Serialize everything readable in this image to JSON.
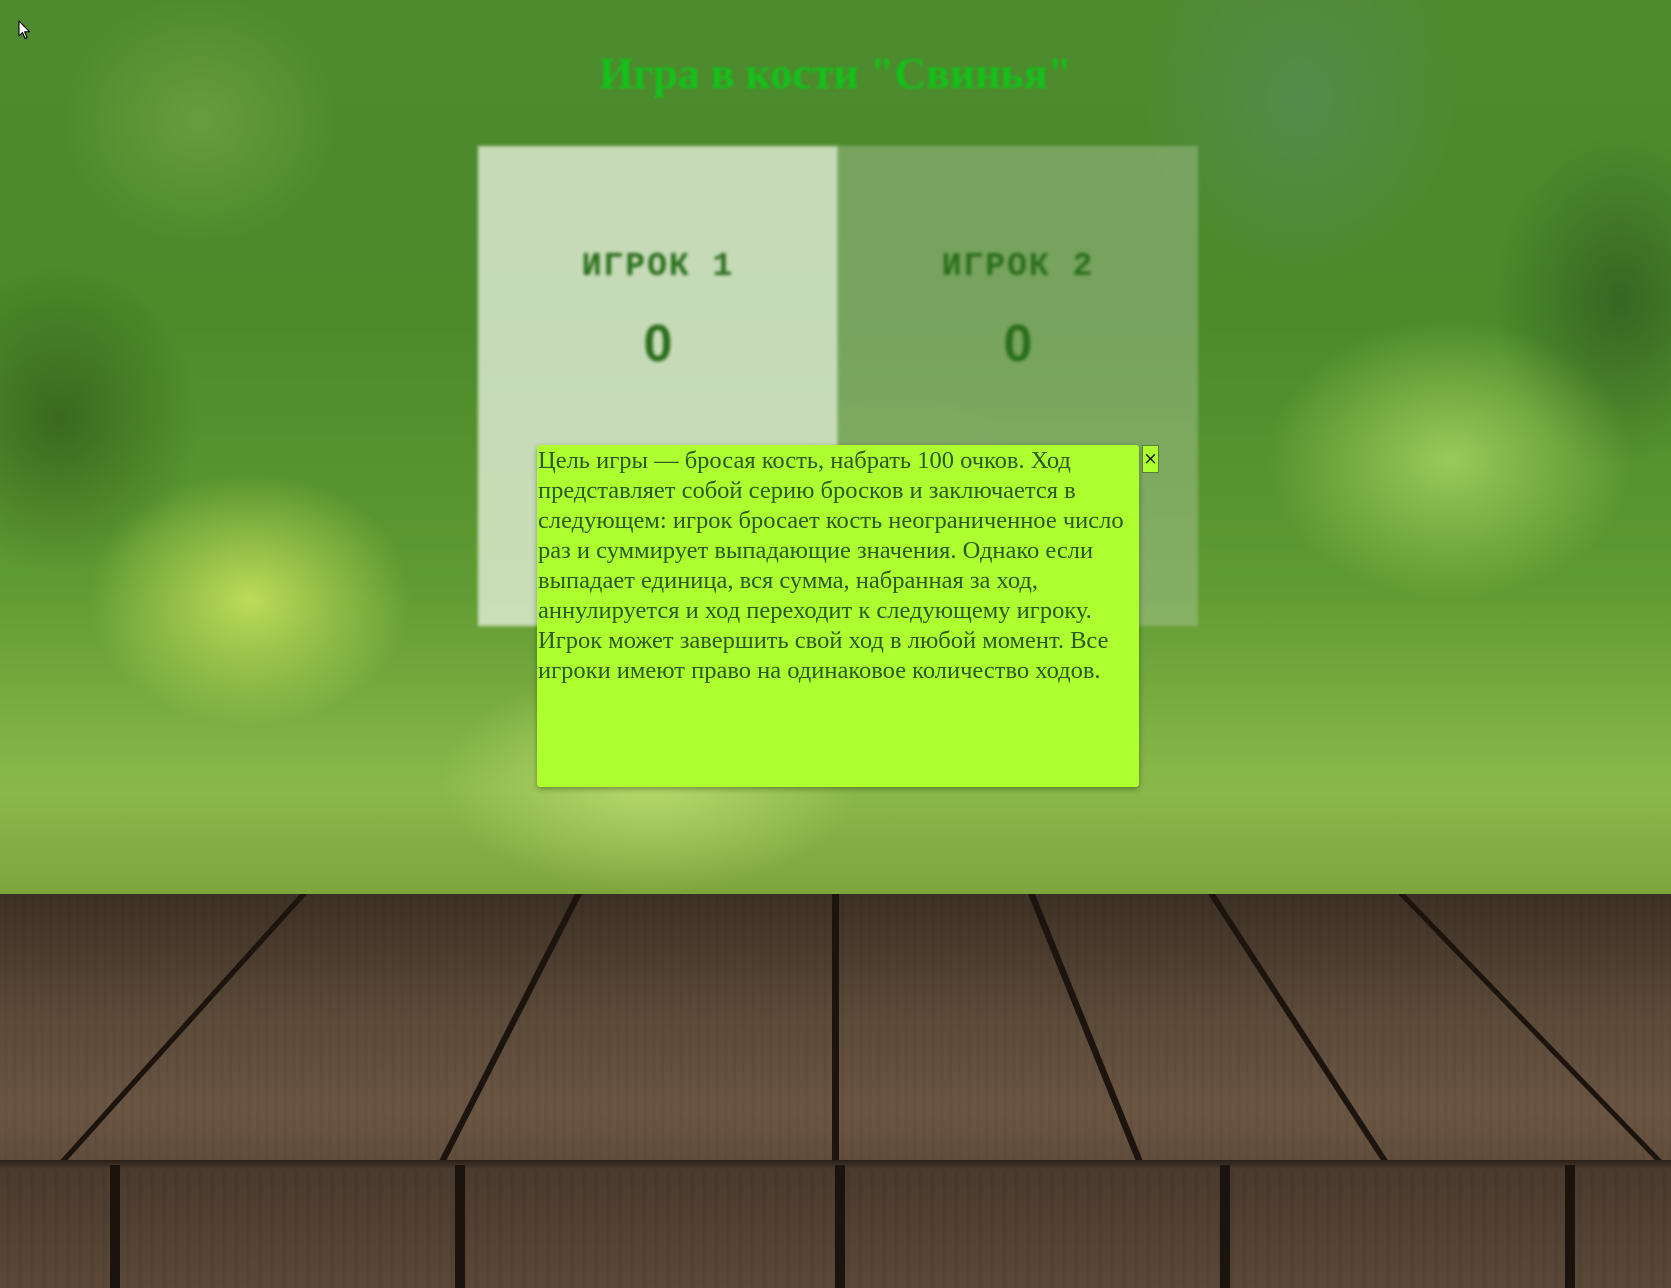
{
  "page": {
    "title": "Игра в кости \"Свинья\""
  },
  "players": [
    {
      "name": "ИГРОК 1",
      "score": "0"
    },
    {
      "name": "ИГРОК 2",
      "score": "0"
    }
  ],
  "rules_modal": {
    "text": "Цель игры — бросая кость, набрать 100 очков. Ход представляет собой серию бросков и заключается в следующем: игрок бросает кость неограниченное число раз и суммирует выпадающие значения. Однако если выпадает единица, вся сумма, набранная за ход, аннулируется и ход переходит к следующему игроку. Игрок может завершить свой ход в любой момент. Все игроки имеют право на одинаковое количество ходов.",
    "close_label": "×"
  },
  "colors": {
    "title": "#13c21a",
    "modal_background": "#adff2f",
    "player_text": "#2a6e1c"
  },
  "icons": {
    "cursor": "arrow-cursor-icon",
    "close": "close-icon"
  }
}
